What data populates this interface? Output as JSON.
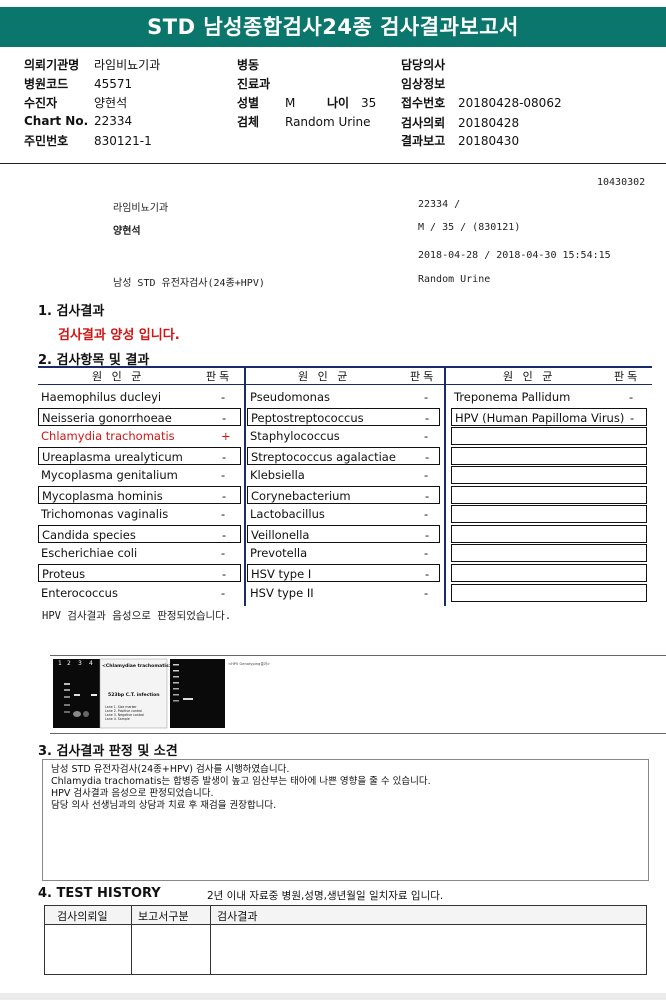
{
  "title": "STD 남성종합검사24종 검사결과보고서",
  "header": {
    "col1": [
      {
        "k": "의뢰기관명",
        "v": "라임비뇨기과"
      },
      {
        "k": "병원코드",
        "v": "45571"
      },
      {
        "k": "수진자",
        "v": "양현석"
      },
      {
        "k": "Chart No.",
        "v": "22334"
      },
      {
        "k": "주민번호",
        "v": "830121-1"
      }
    ],
    "col2": [
      {
        "k": "병동",
        "v": ""
      },
      {
        "k": "진료과",
        "v": ""
      },
      {
        "k": "성별",
        "v": "M"
      },
      {
        "k": "검체",
        "v": "Random Urine"
      }
    ],
    "age_label": "나이",
    "age_value": "35",
    "col3": [
      {
        "k": "담당의사",
        "v": ""
      },
      {
        "k": "임상정보",
        "v": ""
      },
      {
        "k": "접수번호",
        "v": "20180428-08062"
      },
      {
        "k": "검사의뢰",
        "v": "20180428"
      },
      {
        "k": "결과보고",
        "v": "20180430"
      }
    ]
  },
  "info": {
    "code": "10430302",
    "clinic": "라임비뇨기과",
    "chart": "22334         /",
    "name": "양현석",
    "sex_age": "M /    35 / (830121)",
    "dates": "2018-04-28      / 2018-04-30 15:54:15",
    "test_name": "남성 STD 유전자검사(24종+HPV)",
    "specimen": "Random Urine"
  },
  "section1": {
    "title": "1. 검사결과",
    "result": "검사결과 양성 입니다."
  },
  "section2": {
    "title": "2. 검사항목 및 결과",
    "head_name": "원 인 균",
    "head_judge": "판독",
    "col1": [
      {
        "name": "Haemophilus ducleyi",
        "judge": "-"
      },
      {
        "name": "Neisseria gonorrhoeae",
        "judge": "-"
      },
      {
        "name": "Chlamydia trachomatis",
        "judge": "+",
        "positive": true
      },
      {
        "name": "Ureaplasma urealyticum",
        "judge": "-"
      },
      {
        "name": "Mycoplasma genitalium",
        "judge": "-"
      },
      {
        "name": "Mycoplasma hominis",
        "judge": "-"
      },
      {
        "name": "Trichomonas vaginalis",
        "judge": "-"
      },
      {
        "name": "Candida species",
        "judge": "-"
      },
      {
        "name": "Escherichiae coli",
        "judge": "-"
      },
      {
        "name": "Proteus",
        "judge": "-"
      },
      {
        "name": "Enterococcus",
        "judge": "-"
      }
    ],
    "col2": [
      {
        "name": "Pseudomonas",
        "judge": "-"
      },
      {
        "name": "Peptostreptococcus",
        "judge": "-"
      },
      {
        "name": "Staphylococcus",
        "judge": "-"
      },
      {
        "name": "Streptococcus agalactiae",
        "judge": "-"
      },
      {
        "name": "Klebsiella",
        "judge": "-"
      },
      {
        "name": "Corynebacterium",
        "judge": "-"
      },
      {
        "name": "Lactobacillus",
        "judge": "-"
      },
      {
        "name": "Veillonella",
        "judge": "-"
      },
      {
        "name": "Prevotella",
        "judge": "-"
      },
      {
        "name": "HSV type I",
        "judge": "-"
      },
      {
        "name": "HSV type II",
        "judge": "-"
      }
    ],
    "col3": [
      {
        "name": "Treponema Pallidum",
        "judge": "-"
      },
      {
        "name": "HPV (Human Papilloma Virus)",
        "judge": "-"
      }
    ],
    "hpv_note": "HPV 검사결과 음성으로 판정되었습니다."
  },
  "gel": {
    "lanes": [
      "1",
      "2",
      "3",
      "4"
    ],
    "title": "<Chlamydiae trachomatis>",
    "band_label": "523bp C.T. infection",
    "legend": [
      "Lane 1. Size marker",
      "Lane 2. Positive control",
      "Lane 3. Negative control",
      "Lane 4. Sample"
    ],
    "hpv_title": "<HPV Genotyping결과>"
  },
  "section3": {
    "title": "3. 검사결과 판정 및 소견",
    "lines": [
      "남성 STD 유전자검사(24종+HPV) 검사를 시행하였습니다.",
      "Chlamydia trachomatis는 합병증 발생이 높고 임산부는 태아에 나쁜 영향을 줄 수 있습니다.",
      "HPV 검사결과 음성으로 판정되었습니다.",
      "담당 의사 선생님과의 상담과 치료 후 재검을 권장합니다."
    ]
  },
  "section4": {
    "title": "4. TEST HISTORY",
    "note": "2년 이내 자료중 병원,성명,생년월일 일치자료 입니다.",
    "columns": [
      "검사의뢰일",
      "보고서구분",
      "검사결과"
    ]
  }
}
